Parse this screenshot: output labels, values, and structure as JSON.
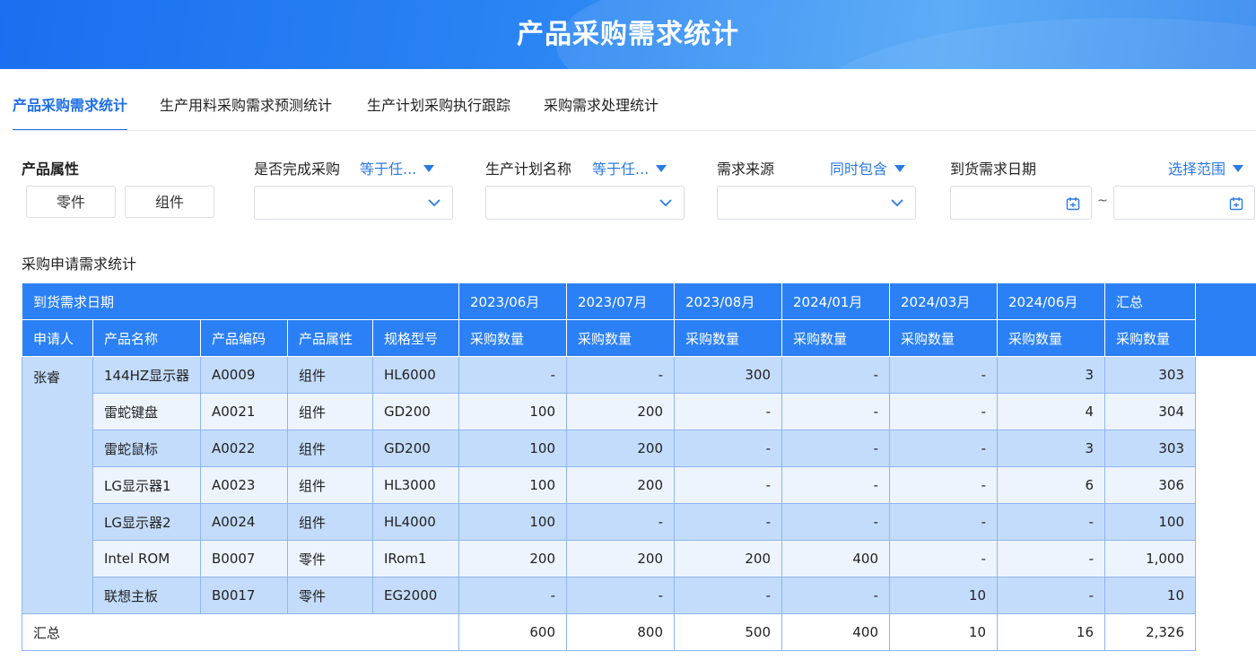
{
  "header": {
    "title": "产品采购需求统计"
  },
  "tabs": [
    {
      "label": "产品采购需求统计",
      "active": true
    },
    {
      "label": "生产用料采购需求预测统计",
      "active": false
    },
    {
      "label": "生产计划采购执行跟踪",
      "active": false
    },
    {
      "label": "采购需求处理统计",
      "active": false
    }
  ],
  "filters": {
    "attribute": {
      "label": "产品属性",
      "buttons": [
        "零件",
        "组件"
      ]
    },
    "purchase_complete": {
      "label": "是否完成采购",
      "operator": "等于任...",
      "value": ""
    },
    "plan_name": {
      "label": "生产计划名称",
      "operator": "等于任...",
      "value": ""
    },
    "source": {
      "label": "需求来源",
      "operator": "同时包含",
      "value": ""
    },
    "arrival_date": {
      "label": "到货需求日期",
      "operator": "选择范围",
      "separator": "~",
      "start": "",
      "end": ""
    }
  },
  "section": {
    "title": "采购申请需求统计"
  },
  "table": {
    "group_header": "到货需求日期",
    "months": [
      "2023/06月",
      "2023/07月",
      "2023/08月",
      "2024/01月",
      "2024/03月",
      "2024/06月"
    ],
    "total_header": "汇总",
    "columns": [
      "申请人",
      "产品名称",
      "产品编码",
      "产品属性",
      "规格型号"
    ],
    "measure": "采购数量",
    "applicant": "张睿",
    "rows": [
      {
        "name": "144HZ显示器",
        "code": "A0009",
        "attr": "组件",
        "spec": "HL6000",
        "vals": [
          "-",
          "-",
          "300",
          "-",
          "-",
          "3"
        ],
        "total": "303"
      },
      {
        "name": "雷蛇键盘",
        "code": "A0021",
        "attr": "组件",
        "spec": "GD200",
        "vals": [
          "100",
          "200",
          "-",
          "-",
          "-",
          "4"
        ],
        "total": "304"
      },
      {
        "name": "雷蛇鼠标",
        "code": "A0022",
        "attr": "组件",
        "spec": "GD200",
        "vals": [
          "100",
          "200",
          "-",
          "-",
          "-",
          "3"
        ],
        "total": "303"
      },
      {
        "name": "LG显示器1",
        "code": "A0023",
        "attr": "组件",
        "spec": "HL3000",
        "vals": [
          "100",
          "200",
          "-",
          "-",
          "-",
          "6"
        ],
        "total": "306"
      },
      {
        "name": "LG显示器2",
        "code": "A0024",
        "attr": "组件",
        "spec": "HL4000",
        "vals": [
          "100",
          "-",
          "-",
          "-",
          "-",
          "-"
        ],
        "total": "100"
      },
      {
        "name": "Intel ROM",
        "code": "B0007",
        "attr": "零件",
        "spec": "IRom1",
        "vals": [
          "200",
          "200",
          "200",
          "400",
          "-",
          "-"
        ],
        "total": "1,000"
      },
      {
        "name": "联想主板",
        "code": "B0017",
        "attr": "零件",
        "spec": "EG2000",
        "vals": [
          "-",
          "-",
          "-",
          "-",
          "10",
          "-"
        ],
        "total": "10"
      }
    ],
    "summary": {
      "label": "汇总",
      "vals": [
        "600",
        "800",
        "500",
        "400",
        "10",
        "16"
      ],
      "total": "2,326"
    }
  },
  "colors": {
    "accent": "#1e6fe8",
    "table_header": "#2b80f6",
    "row_dark": "#c4dcfb",
    "row_light": "#edf4fe"
  }
}
